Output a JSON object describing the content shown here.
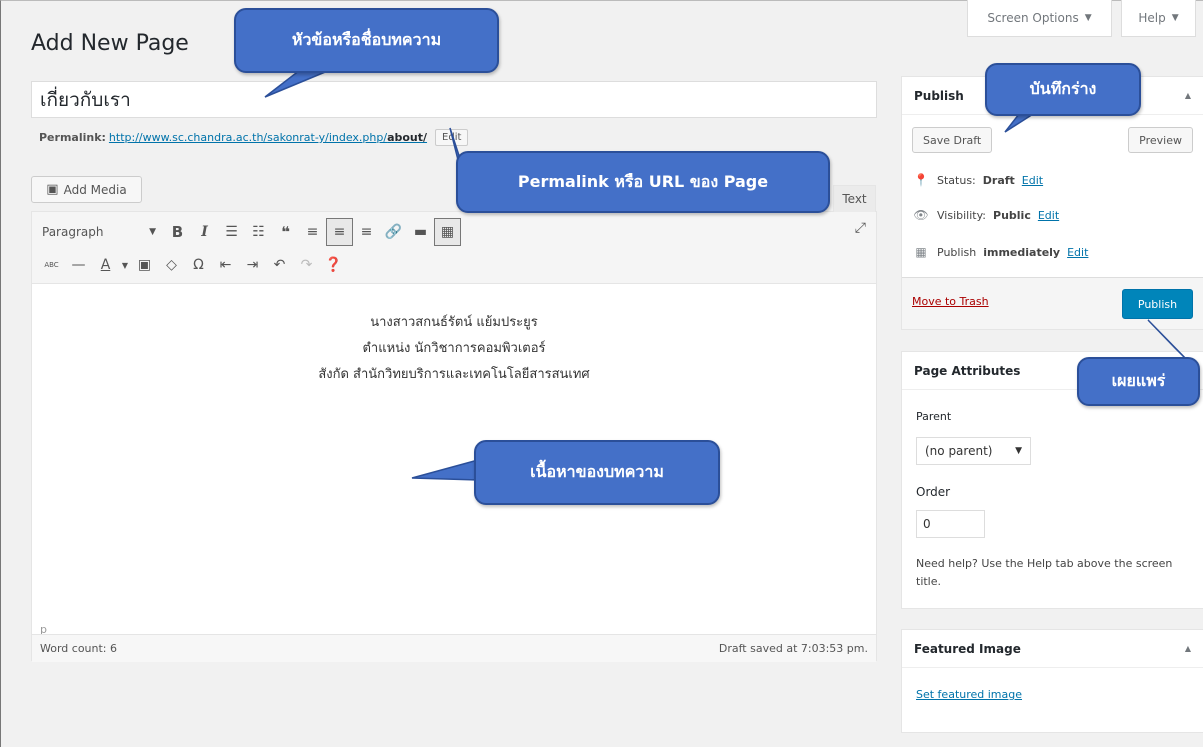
{
  "header": {
    "title": "Add New Page",
    "screen_options": "Screen Options",
    "help": "Help"
  },
  "post": {
    "title": "เกี่ยวกับเรา",
    "permalink_label": "Permalink:",
    "permalink_base": "http://www.sc.chandra.ac.th/sakonrat-y/index.php/",
    "permalink_slug": "about/",
    "permalink_edit": "Edit"
  },
  "editor": {
    "add_media": "Add Media",
    "text_tab": "Text",
    "format_select": "Paragraph",
    "content_lines": [
      "นางสาวสกนธ์รัตน์ แย้มประยูร",
      "ตำแหน่ง นักวิชาการคอมพิวเตอร์",
      "สังกัด สำนักวิทยบริการและเทคโนโลยีสารสนเทศ"
    ],
    "path": "p",
    "word_count": "Word count: 6",
    "draft_saved": "Draft saved at 7:03:53 pm."
  },
  "publish_box": {
    "title": "Publish",
    "save_draft": "Save Draft",
    "preview": "Preview",
    "status_label": "Status:",
    "status_value": "Draft",
    "visibility_label": "Visibility:",
    "visibility_value": "Public",
    "publish_label": "Publish",
    "publish_value": "immediately",
    "edit": "Edit",
    "move_to_trash": "Move to Trash",
    "publish_button": "Publish"
  },
  "attributes_box": {
    "title": "Page Attributes",
    "parent_label": "Parent",
    "parent_value": "(no parent)",
    "order_label": "Order",
    "order_value": "0",
    "help_text": "Need help? Use the Help tab above the screen title."
  },
  "featured_box": {
    "title": "Featured Image",
    "set_link": "Set featured image"
  },
  "callouts": {
    "title": "หัวข้อหรือชื่อบทความ",
    "permalink": "Permalink หรือ URL ของ Page",
    "content": "เนื้อหาของบทความ",
    "save_draft": "บันทึกร่าง",
    "publish": "เผยแพร่"
  },
  "colors": {
    "accent": "#0085ba",
    "callout": "#4470c8",
    "trash": "#a00"
  }
}
